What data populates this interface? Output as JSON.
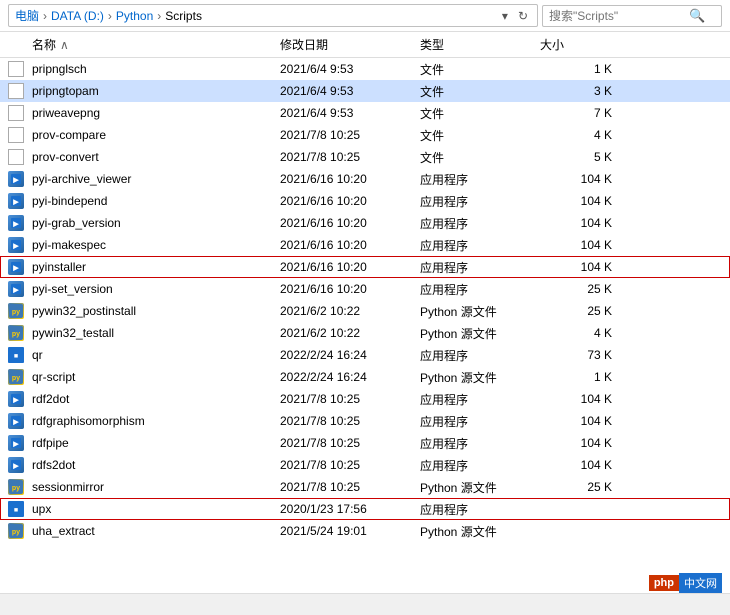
{
  "addressBar": {
    "breadcrumbs": [
      "电脑",
      "DATA (D:)",
      "Python",
      "Scripts"
    ],
    "separators": [
      "›",
      "›",
      "›"
    ],
    "searchPlaceholder": "搜索\"Scripts\"",
    "refreshIcon": "↻",
    "dropdownIcon": "▾"
  },
  "columns": {
    "name": "名称",
    "nameArrow": "∧",
    "date": "修改日期",
    "type": "类型",
    "size": "大小"
  },
  "files": [
    {
      "name": "pripnglsch",
      "date": "2021/6/4 9:53",
      "type": "文件",
      "size": "1 K",
      "icon": "plain",
      "selected": false,
      "highlighted": false
    },
    {
      "name": "pripngtopam",
      "date": "2021/6/4 9:53",
      "type": "文件",
      "size": "3 K",
      "icon": "plain",
      "selected": true,
      "highlighted": false
    },
    {
      "name": "priweavepng",
      "date": "2021/6/4 9:53",
      "type": "文件",
      "size": "7 K",
      "icon": "plain",
      "selected": false,
      "highlighted": false
    },
    {
      "name": "prov-compare",
      "date": "2021/7/8 10:25",
      "type": "文件",
      "size": "4 K",
      "icon": "plain",
      "selected": false,
      "highlighted": false
    },
    {
      "name": "prov-convert",
      "date": "2021/7/8 10:25",
      "type": "文件",
      "size": "5 K",
      "icon": "plain",
      "selected": false,
      "highlighted": false
    },
    {
      "name": "pyi-archive_viewer",
      "date": "2021/6/16 10:20",
      "type": "应用程序",
      "size": "104 K",
      "icon": "app",
      "selected": false,
      "highlighted": false
    },
    {
      "name": "pyi-bindepend",
      "date": "2021/6/16 10:20",
      "type": "应用程序",
      "size": "104 K",
      "icon": "app",
      "selected": false,
      "highlighted": false
    },
    {
      "name": "pyi-grab_version",
      "date": "2021/6/16 10:20",
      "type": "应用程序",
      "size": "104 K",
      "icon": "app",
      "selected": false,
      "highlighted": false
    },
    {
      "name": "pyi-makespec",
      "date": "2021/6/16 10:20",
      "type": "应用程序",
      "size": "104 K",
      "icon": "app",
      "selected": false,
      "highlighted": false
    },
    {
      "name": "pyinstaller",
      "date": "2021/6/16 10:20",
      "type": "应用程序",
      "size": "104 K",
      "icon": "app",
      "selected": false,
      "highlighted": true
    },
    {
      "name": "pyi-set_version",
      "date": "2021/6/16 10:20",
      "type": "应用程序",
      "size": "25 K",
      "icon": "app",
      "selected": false,
      "highlighted": false
    },
    {
      "name": "pywin32_postinstall",
      "date": "2021/6/2 10:22",
      "type": "Python 源文件",
      "size": "25 K",
      "icon": "py",
      "selected": false,
      "highlighted": false
    },
    {
      "name": "pywin32_testall",
      "date": "2021/6/2 10:22",
      "type": "Python 源文件",
      "size": "4 K",
      "icon": "py",
      "selected": false,
      "highlighted": false
    },
    {
      "name": "qr",
      "date": "2022/2/24 16:24",
      "type": "应用程序",
      "size": "73 K",
      "icon": "blue-square",
      "selected": false,
      "highlighted": false
    },
    {
      "name": "qr-script",
      "date": "2022/2/24 16:24",
      "type": "Python 源文件",
      "size": "1 K",
      "icon": "py",
      "selected": false,
      "highlighted": false
    },
    {
      "name": "rdf2dot",
      "date": "2021/7/8 10:25",
      "type": "应用程序",
      "size": "104 K",
      "icon": "app",
      "selected": false,
      "highlighted": false
    },
    {
      "name": "rdfgraphisomorphism",
      "date": "2021/7/8 10:25",
      "type": "应用程序",
      "size": "104 K",
      "icon": "app",
      "selected": false,
      "highlighted": false
    },
    {
      "name": "rdfpipe",
      "date": "2021/7/8 10:25",
      "type": "应用程序",
      "size": "104 K",
      "icon": "app",
      "selected": false,
      "highlighted": false
    },
    {
      "name": "rdfs2dot",
      "date": "2021/7/8 10:25",
      "type": "应用程序",
      "size": "104 K",
      "icon": "app",
      "selected": false,
      "highlighted": false
    },
    {
      "name": "sessionmirror",
      "date": "2021/7/8 10:25",
      "type": "Python 源文件",
      "size": "25 K",
      "icon": "py",
      "selected": false,
      "highlighted": false
    },
    {
      "name": "upx",
      "date": "2020/1/23 17:56",
      "type": "应用程序",
      "size": "",
      "icon": "blue-square",
      "selected": false,
      "highlighted": true
    },
    {
      "name": "uha_extract",
      "date": "2021/5/24 19:01",
      "type": "Python 源文件",
      "size": "",
      "icon": "py",
      "selected": false,
      "highlighted": false
    }
  ],
  "watermark": {
    "phpLabel": "php",
    "cnLabel": "中文网"
  },
  "bottomBar": {
    "text": ""
  }
}
